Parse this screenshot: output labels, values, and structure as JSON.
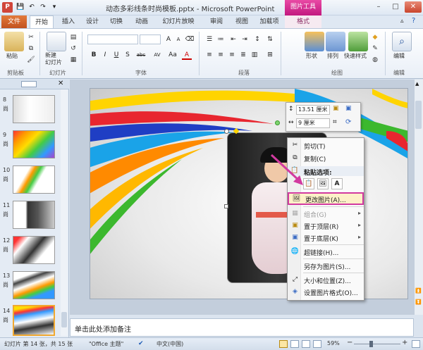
{
  "titlebar": {
    "title": "动态多彩线条时尚模板.pptx  -  Microsoft PowerPoint",
    "context_tab_group": "图片工具",
    "app_icon": "P",
    "min": "–",
    "max": "□",
    "close": "✕"
  },
  "tabs": [
    "文件",
    "开始",
    "插入",
    "设计",
    "切换",
    "动画",
    "幻灯片放映",
    "审阅",
    "视图",
    "加载项",
    "格式"
  ],
  "ribbon": {
    "groups": {
      "clipboard": "剪贴板",
      "slides": "幻灯片",
      "font": "字体",
      "paragraph": "段落",
      "drawing": "绘图",
      "editing": "编辑"
    },
    "paste_label": "粘贴",
    "new_slide_label": "新建\n幻灯片",
    "shapes_label": "形状",
    "arrange_label": "排列",
    "quick_styles_label": "快速样式",
    "editing_label": "编辑",
    "font_buttons": [
      "B",
      "I",
      "U",
      "S",
      "abc",
      "AV",
      "Aa",
      "A"
    ]
  },
  "slides_panel": {
    "slides": [
      {
        "num": "8",
        "note": "尚"
      },
      {
        "num": "9",
        "note": "尚"
      },
      {
        "num": "10",
        "note": "尚"
      },
      {
        "num": "11",
        "note": "尚"
      },
      {
        "num": "12",
        "note": "尚"
      },
      {
        "num": "13",
        "note": "尚"
      },
      {
        "num": "14",
        "note": "尚"
      }
    ],
    "close_icon": "✕"
  },
  "minitoolbar": {
    "height_value": "13.51 厘米",
    "width_value": "9 厘米"
  },
  "context_menu": {
    "items": [
      {
        "label": "剪切(T)",
        "icon": "scissors-icon"
      },
      {
        "label": "复制(C)",
        "icon": "copy-icon"
      },
      {
        "label": "粘贴选项:",
        "icon": "paste-icon"
      },
      {
        "label": "更改图片(A)...",
        "icon": "change-picture-icon"
      },
      {
        "label": "组合(G)",
        "icon": "group-icon"
      },
      {
        "label": "置于顶层(R)",
        "icon": "bring-front-icon"
      },
      {
        "label": "置于底层(K)",
        "icon": "send-back-icon"
      },
      {
        "label": "超链接(H)...",
        "icon": "hyperlink-icon"
      },
      {
        "label": "另存为图片(S)...",
        "icon": ""
      },
      {
        "label": "大小和位置(Z)...",
        "icon": "size-icon"
      },
      {
        "label": "设置图片格式(O)...",
        "icon": "format-picture-icon"
      }
    ],
    "paste_options": [
      "📋",
      "🖼",
      "A"
    ]
  },
  "notes": {
    "placeholder": "单击此处添加备注"
  },
  "statusbar": {
    "slide_info": "幻灯片 第 14 张，共 15 张",
    "theme": "\"Office 主题\"",
    "language": "中文(中国)",
    "zoom": "59%",
    "minus": "−",
    "plus": "+"
  },
  "colors": {
    "accent_file": "#d2601f",
    "context_pink": "#d23aa0",
    "ribbon_bg": "#e9eff7"
  }
}
